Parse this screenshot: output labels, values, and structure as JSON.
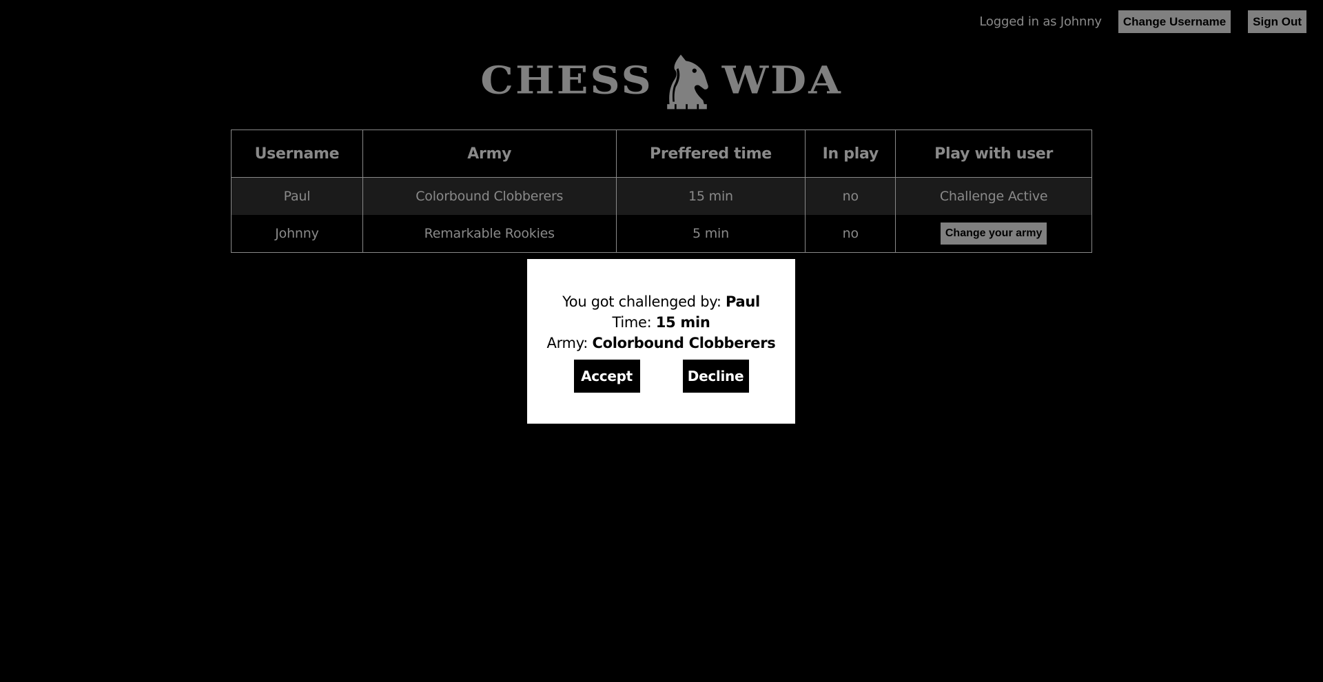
{
  "header": {
    "logged_in_text": "Logged in as Johnny",
    "change_username_label": "Change Username",
    "sign_out_label": "Sign Out"
  },
  "logo": {
    "left_word": "CHESS",
    "right_word": "WDA",
    "icon": "knight-chess-piece-icon"
  },
  "table": {
    "columns": [
      "Username",
      "Army",
      "Preffered time",
      "In play",
      "Play with user"
    ],
    "rows": [
      {
        "username": "Paul",
        "army": "Colorbound Clobberers",
        "time": "15 min",
        "in_play": "no",
        "action": "Challenge Active"
      },
      {
        "username": "Johnny",
        "army": "Remarkable Rookies",
        "time": "5 min",
        "in_play": "no",
        "action": "Change your army"
      }
    ]
  },
  "challenge": {
    "challenger_label": "You got challenged by: ",
    "challenger": "Paul",
    "time_label": "Time: ",
    "time": "15 min",
    "army_label": "Army: ",
    "army": "Colorbound Clobberers",
    "accept_label": "Accept",
    "decline_label": "Decline"
  },
  "colors": {
    "background": "#000000",
    "text_muted": "#8a8a8a",
    "button_gray": "#808080",
    "row_shaded": "#1b1b1b",
    "modal_bg": "#ffffff"
  }
}
